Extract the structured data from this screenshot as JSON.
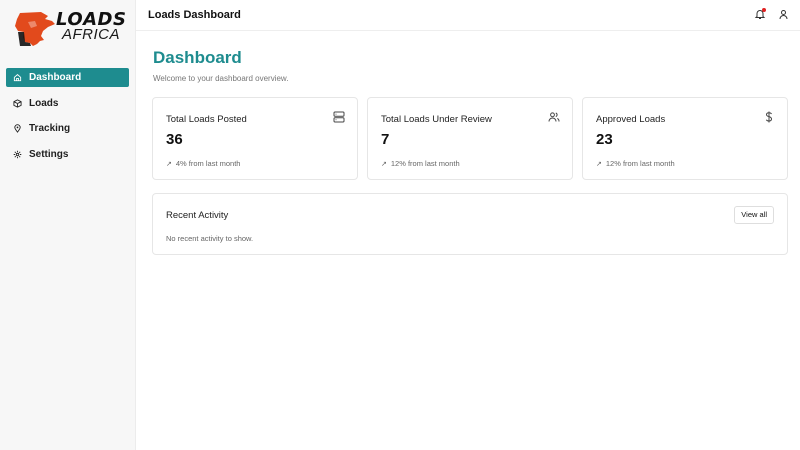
{
  "brand": {
    "name": "LOADS",
    "sub": "AFRICA",
    "accent": "#1e8c8f",
    "logo_red": "#e24a1c"
  },
  "sidebar": {
    "items": [
      {
        "label": "Dashboard",
        "icon": "home-icon",
        "active": true
      },
      {
        "label": "Loads",
        "icon": "package-icon",
        "active": false
      },
      {
        "label": "Tracking",
        "icon": "map-pin-icon",
        "active": false
      },
      {
        "label": "Settings",
        "icon": "gear-icon",
        "active": false
      }
    ]
  },
  "header": {
    "title": "Loads Dashboard",
    "icons": [
      "bell-icon",
      "user-icon"
    ]
  },
  "main": {
    "title": "Dashboard",
    "subtitle": "Welcome to your dashboard overview.",
    "stats": [
      {
        "label": "Total Loads Posted",
        "value": "36",
        "trend": "4% from last month",
        "icon": "server-icon"
      },
      {
        "label": "Total Loads Under Review",
        "value": "7",
        "trend": "12% from last month",
        "icon": "users-icon"
      },
      {
        "label": "Approved Loads",
        "value": "23",
        "trend": "12% from last month",
        "icon": "dollar-icon"
      }
    ],
    "activity": {
      "title": "Recent Activity",
      "view_all": "View all",
      "empty": "No recent activity to show."
    }
  }
}
